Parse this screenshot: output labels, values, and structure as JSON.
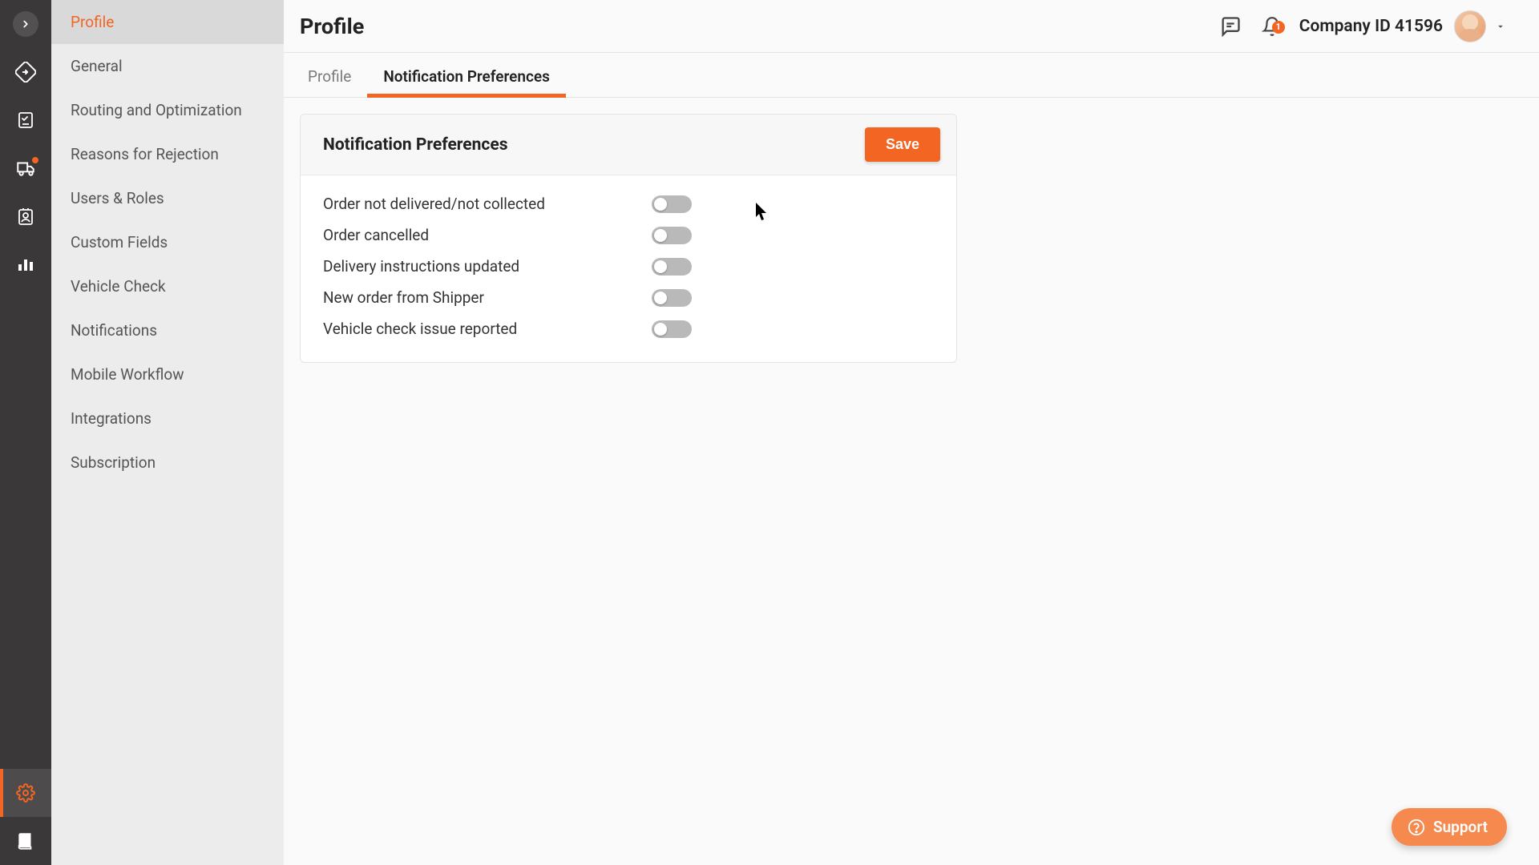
{
  "header": {
    "page_title": "Profile",
    "company_id_label": "Company ID 41596",
    "bell_badge": "1"
  },
  "sidebar": {
    "items": [
      {
        "label": "Profile"
      },
      {
        "label": "General"
      },
      {
        "label": "Routing and Optimization"
      },
      {
        "label": "Reasons for Rejection"
      },
      {
        "label": "Users & Roles"
      },
      {
        "label": "Custom Fields"
      },
      {
        "label": "Vehicle Check"
      },
      {
        "label": "Notifications"
      },
      {
        "label": "Mobile Workflow"
      },
      {
        "label": "Integrations"
      },
      {
        "label": "Subscription"
      }
    ]
  },
  "tabs": {
    "profile": "Profile",
    "notif": "Notification Preferences"
  },
  "card": {
    "title": "Notification Preferences",
    "save_label": "Save"
  },
  "prefs": [
    {
      "label": "Order not delivered/not collected"
    },
    {
      "label": "Order cancelled"
    },
    {
      "label": "Delivery instructions updated"
    },
    {
      "label": "New order from Shipper"
    },
    {
      "label": "Vehicle check issue reported"
    }
  ],
  "support": {
    "label": "Support"
  }
}
